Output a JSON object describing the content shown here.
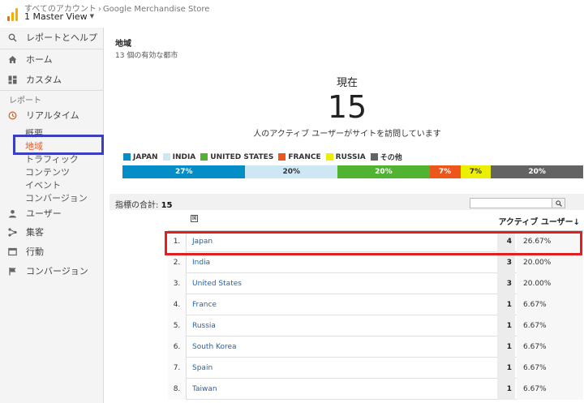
{
  "header": {
    "breadcrumb_accounts": "すべてのアカウント",
    "breadcrumb_sep": "›",
    "breadcrumb_property": "Google Merchandise Store",
    "view_name": "1 Master View"
  },
  "sidebar": {
    "search": "レポートとヘルプ",
    "home": "ホーム",
    "custom": "カスタム",
    "reports_head": "レポート",
    "realtime": "リアルタイム",
    "realtime_sub": [
      "概要",
      "地域",
      "トラフィック",
      "コンテンツ",
      "イベント",
      "コンバージョン"
    ],
    "audience": "ユーザー",
    "acquisition": "集客",
    "behavior": "行動",
    "conversions": "コンバージョン"
  },
  "card": {
    "title": "地域",
    "subtitle": "13 個の有効な都市",
    "now_label": "現在",
    "now_value": "15",
    "now_desc": "人のアクティブ ユーザーがサイトを訪問しています"
  },
  "legend": [
    {
      "label": "JAPAN",
      "color": "#058dc7"
    },
    {
      "label": "INDIA",
      "color": "#cde7f5"
    },
    {
      "label": "UNITED STATES",
      "color": "#50b432"
    },
    {
      "label": "FRANCE",
      "color": "#ed561b"
    },
    {
      "label": "RUSSIA",
      "color": "#edef00"
    },
    {
      "label": "その他",
      "color": "#636363"
    }
  ],
  "share_bar": [
    {
      "label": "27%",
      "value": 26.67,
      "color": "#058dc7",
      "text_color": "#ffffff"
    },
    {
      "label": "20%",
      "value": 20,
      "color": "#cde7f5",
      "text_color": "#333333"
    },
    {
      "label": "20%",
      "value": 20,
      "color": "#50b432",
      "text_color": "#ffffff"
    },
    {
      "label": "7%",
      "value": 6.67,
      "color": "#ed561b",
      "text_color": "#ffffff"
    },
    {
      "label": "7%",
      "value": 6.67,
      "color": "#edef00",
      "text_color": "#333333"
    },
    {
      "label": "20%",
      "value": 20,
      "color": "#636363",
      "text_color": "#ffffff"
    }
  ],
  "summary": {
    "label": "指標の合計:",
    "total": "15"
  },
  "table": {
    "globe_icon": "国",
    "col_active": "アクティブ ユーザー↓",
    "rows": [
      {
        "num": "1.",
        "name": "Japan",
        "count": "4",
        "pct": "26.67%"
      },
      {
        "num": "2.",
        "name": "India",
        "count": "3",
        "pct": "20.00%"
      },
      {
        "num": "3.",
        "name": "United States",
        "count": "3",
        "pct": "20.00%"
      },
      {
        "num": "4.",
        "name": "France",
        "count": "1",
        "pct": "6.67%"
      },
      {
        "num": "5.",
        "name": "Russia",
        "count": "1",
        "pct": "6.67%"
      },
      {
        "num": "6.",
        "name": "South Korea",
        "count": "1",
        "pct": "6.67%"
      },
      {
        "num": "7.",
        "name": "Spain",
        "count": "1",
        "pct": "6.67%"
      },
      {
        "num": "8.",
        "name": "Taiwan",
        "count": "1",
        "pct": "6.67%"
      }
    ]
  }
}
